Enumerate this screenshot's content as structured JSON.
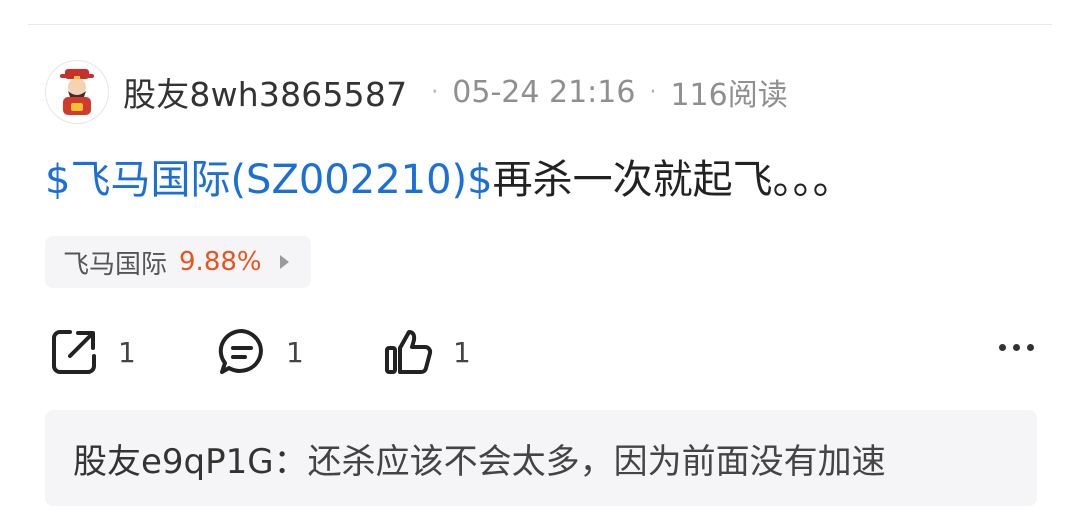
{
  "post": {
    "username": "股友8wh3865587",
    "date": "05-24 21:16",
    "reads": "116阅读",
    "stock_link": "$飞马国际(SZ002210)$",
    "content": "再杀一次就起飞。。。"
  },
  "stock_chip": {
    "name": "飞马国际",
    "change": "9.88%",
    "change_color": "#e8541e"
  },
  "actions": {
    "share_count": "1",
    "comment_count": "1",
    "like_count": "1"
  },
  "comment": {
    "author": "股友e9qP1G",
    "separator": "：",
    "text": "还杀应该不会太多，因为前面没有加速"
  },
  "icons": {
    "share": "share-icon",
    "comment": "comment-icon",
    "like": "thumbs-up-icon",
    "more": "more-icon"
  },
  "colors": {
    "link": "#1b6fd8",
    "up": "#e8541e"
  }
}
